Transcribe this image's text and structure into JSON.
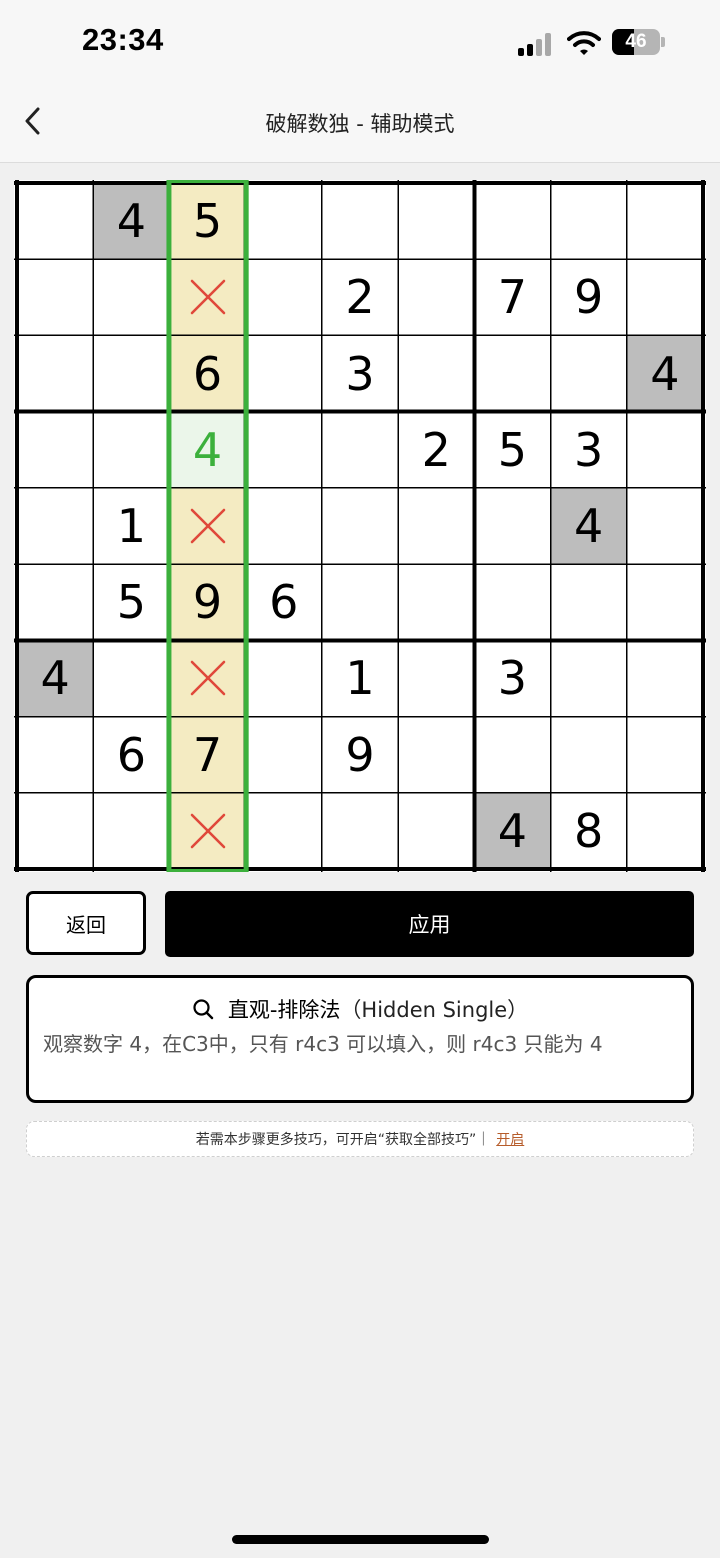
{
  "status_bar": {
    "time": "23:34",
    "battery_percent": "46"
  },
  "header": {
    "title": "破解数独 - 辅助模式",
    "back_icon": "chevron-left-icon"
  },
  "board": {
    "cells": [
      [
        "",
        "4",
        "5",
        "",
        "",
        "",
        "",
        "",
        ""
      ],
      [
        "",
        "",
        "x",
        "",
        "2",
        "",
        "7",
        "9",
        ""
      ],
      [
        "",
        "",
        "6",
        "",
        "3",
        "",
        "",
        "",
        "4"
      ],
      [
        "",
        "",
        "4",
        "",
        "",
        "2",
        "5",
        "3",
        ""
      ],
      [
        "",
        "1",
        "x",
        "",
        "",
        "",
        "",
        "4",
        ""
      ],
      [
        "",
        "5",
        "9",
        "6",
        "",
        "",
        "",
        "",
        ""
      ],
      [
        "4",
        "",
        "x",
        "",
        "1",
        "",
        "3",
        "",
        ""
      ],
      [
        "",
        "6",
        "7",
        "",
        "9",
        "",
        "",
        "",
        ""
      ],
      [
        "",
        "",
        "x",
        "",
        "",
        "",
        "4",
        "8",
        ""
      ]
    ],
    "highlighted_column": 3,
    "target_cell": "r4c3",
    "candidate_digit": "4",
    "same_digit_cells": [
      "r1c2",
      "r3c9",
      "r5c8",
      "r7c1",
      "r9c7"
    ],
    "colors": {
      "column_highlight": "#f4ebc2",
      "column_border": "#3cb03c",
      "target_background": "#ebf6ea",
      "hint_digit": "#3cb03c",
      "same_digit_background": "#bdbdbd",
      "elimination_mark": "#e0483a"
    }
  },
  "actions": {
    "back_label": "返回",
    "apply_label": "应用"
  },
  "hint_card": {
    "icon": "search-icon",
    "technique_cn": "直观-排除法",
    "technique_en": "（Hidden Single）",
    "description": "观察数字 4，在C3中，只有 r4c3 可以填入，则 r4c3 只能为 4"
  },
  "tip": {
    "text": "若需本步骤更多技巧，可开启“获取全部技巧”｜",
    "link": "开启"
  }
}
